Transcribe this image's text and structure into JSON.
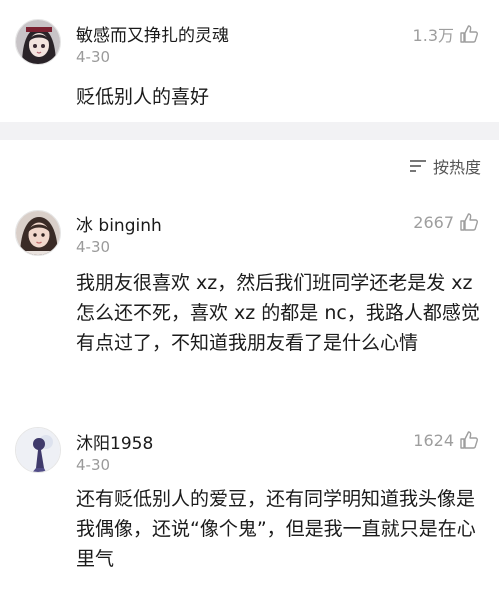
{
  "comments": [
    {
      "username": "敏感而又挣扎的灵魂",
      "date": "4-30",
      "likes": "1.3万",
      "text": "贬低别人的喜好",
      "avatar": "anime-girl-avatar"
    },
    {
      "username": "冰 binginh",
      "date": "4-30",
      "likes": "2667",
      "text": "我朋友很喜欢 xz，然后我们班同学还老是发 xz 怎么还不死，喜欢 xz 的都是 nc，我路人都感觉有点过了，不知道我朋友看了是什么心情",
      "avatar": "girl-photo-avatar"
    },
    {
      "username": "沐阳1958",
      "date": "4-30",
      "likes": "1624",
      "text": "还有贬低别人的爱豆，还有同学明知道我头像是我偶像，还说“像个鬼”，但是我一直就只是在心里气",
      "avatar": "silhouette-avatar"
    }
  ],
  "sort": {
    "label": "按热度",
    "icon": "sort-icon"
  },
  "icons": {
    "like": "thumbs-up-icon"
  },
  "colors": {
    "secondary_text": "#9a9a9a",
    "divider": "#f2f2f4",
    "primary_text": "#1b1b1b"
  }
}
